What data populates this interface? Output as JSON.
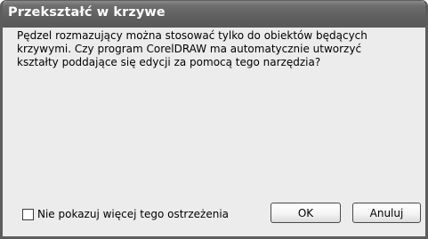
{
  "dialog": {
    "title": "Przekształć w krzywe",
    "message_lines": [
      "Pędzel rozmazujący można stosować tylko do obiektów będących",
      "krzywymi. Czy program CorelDRAW ma automatycznie utworzyć",
      "kształty poddające się edycji za pomocą tego narzędzia?"
    ],
    "checkbox": {
      "label": "Nie pokazuj więcej tego ostrzeżenia",
      "checked": false
    },
    "buttons": {
      "ok_label": "OK",
      "cancel_label": "Anuluj"
    }
  }
}
